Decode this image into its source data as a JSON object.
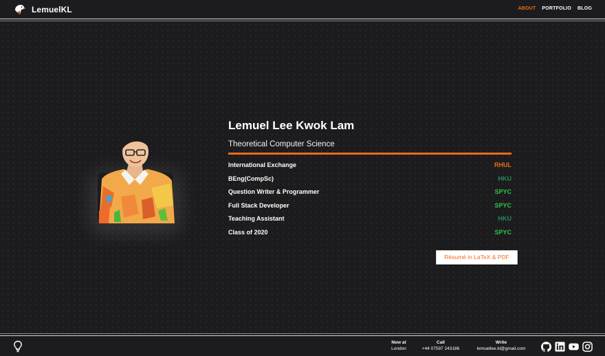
{
  "header": {
    "brand": "LemuelKL",
    "logo_icon": "eagle-icon",
    "nav": [
      {
        "label": "ABOUT",
        "active": true
      },
      {
        "label": "PORTFOLIO",
        "active": false
      },
      {
        "label": "BLOG",
        "active": false
      }
    ]
  },
  "profile": {
    "photo_icon": "profile-photo",
    "name": "Lemuel Lee Kwok Lam",
    "field": "Theoretical Computer Science",
    "roles": [
      {
        "title": "International Exchange",
        "org": "RHUL",
        "color": "#f26b1d"
      },
      {
        "title": "BEng(CompSc)",
        "org": "HKU",
        "color": "#1f8a5c"
      },
      {
        "title": "Question Writer & Programmer",
        "org": "SPYC",
        "color": "#2fc34a"
      },
      {
        "title": "Full Stack Developer",
        "org": "SPYC",
        "color": "#2fc34a"
      },
      {
        "title": "Teaching Assistant",
        "org": "HKU",
        "color": "#1f8a5c"
      },
      {
        "title": "Class of 2020",
        "org": "SPYC",
        "color": "#2fc34a"
      }
    ],
    "resume_button": "Résumé in LaTeX & PDF"
  },
  "colors": {
    "accent": "#f26b1d",
    "background": "#1c1c1e",
    "hku": "#1f8a5c",
    "spyc": "#2fc34a"
  },
  "footer": {
    "bulb_icon": "lightbulb-icon",
    "contacts": [
      {
        "label": "Now at",
        "value": "London"
      },
      {
        "label": "Call",
        "value": "+44 07597 243186"
      },
      {
        "label": "Write",
        "value": "lemuellee.kl@gmail.com"
      }
    ],
    "socials": [
      "github-icon",
      "linkedin-icon",
      "youtube-icon",
      "instagram-icon"
    ]
  }
}
